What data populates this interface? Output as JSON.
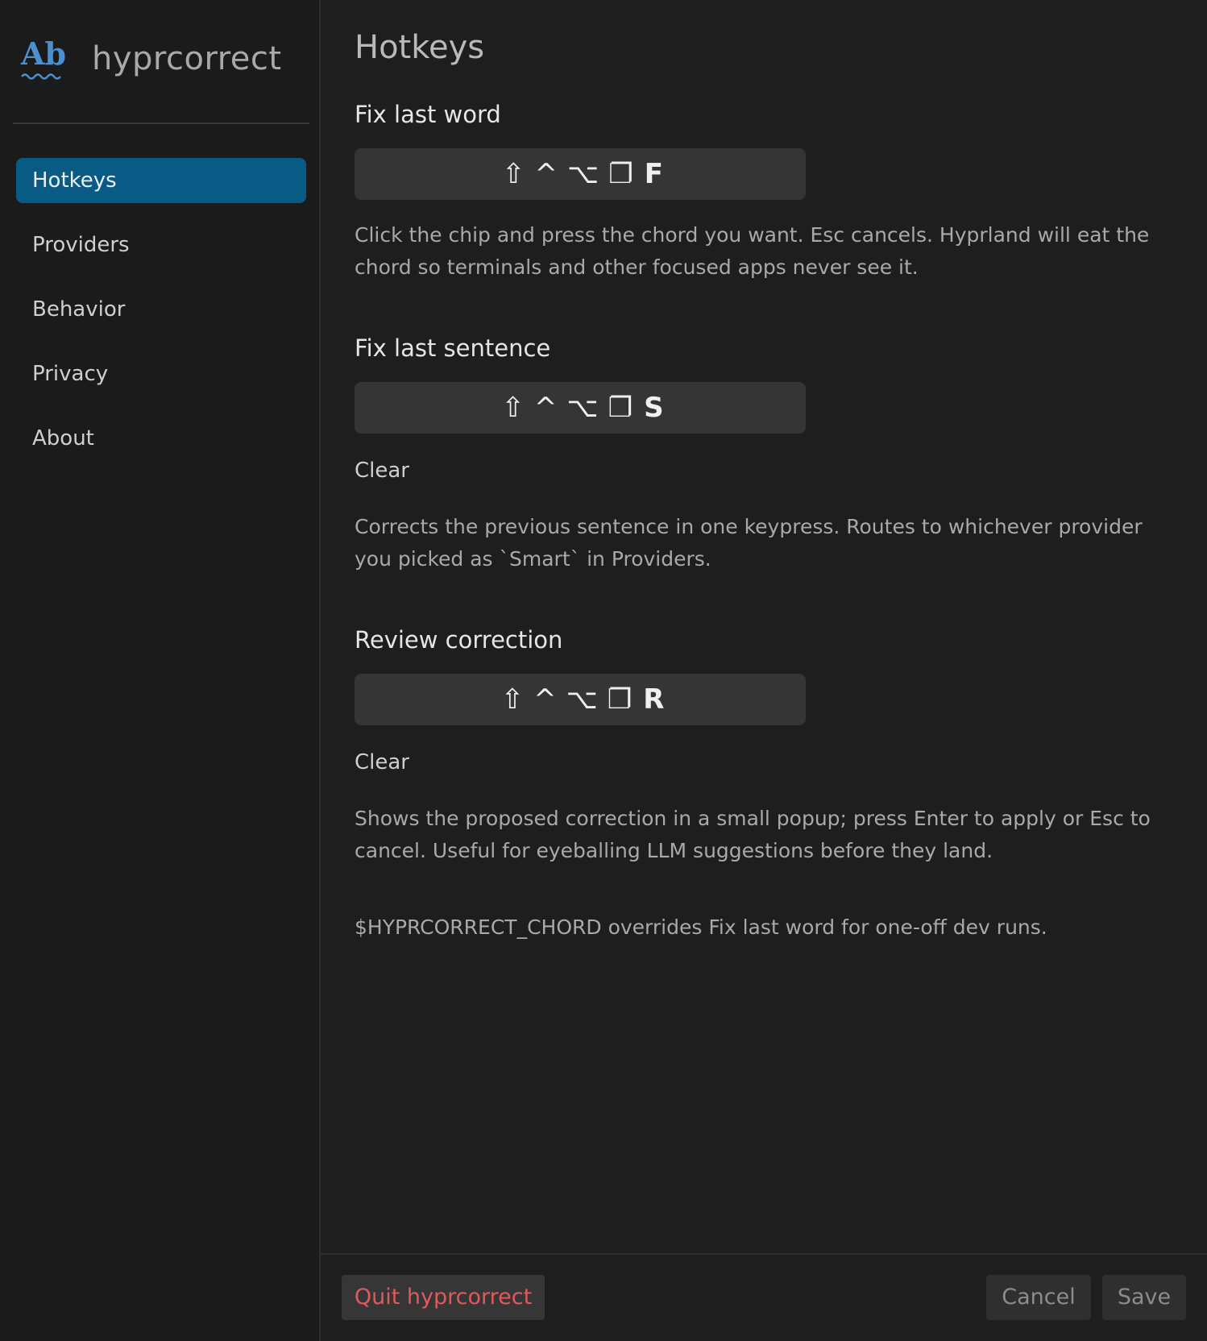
{
  "app": {
    "logo_text": "Ab",
    "name": "hyprcorrect"
  },
  "sidebar": {
    "items": [
      {
        "label": "Hotkeys",
        "active": true
      },
      {
        "label": "Providers",
        "active": false
      },
      {
        "label": "Behavior",
        "active": false
      },
      {
        "label": "Privacy",
        "active": false
      },
      {
        "label": "About",
        "active": false
      }
    ]
  },
  "main": {
    "title": "Hotkeys",
    "sections": [
      {
        "title": "Fix last word",
        "chord": {
          "mods": [
            "⇧",
            "^",
            "⌥",
            "❐"
          ],
          "key": "F"
        },
        "clear_label": "",
        "help": "Click the chip and press the chord you want. Esc cancels. Hyprland will eat the chord so terminals and other focused apps never see it."
      },
      {
        "title": "Fix last sentence",
        "chord": {
          "mods": [
            "⇧",
            "^",
            "⌥",
            "❐"
          ],
          "key": "S"
        },
        "clear_label": "Clear",
        "help": "Corrects the previous sentence in one keypress. Routes to whichever provider you picked as `Smart` in Providers."
      },
      {
        "title": "Review correction",
        "chord": {
          "mods": [
            "⇧",
            "^",
            "⌥",
            "❐"
          ],
          "key": "R"
        },
        "clear_label": "Clear",
        "help": "Shows the proposed correction in a small popup; press Enter to apply or Esc to cancel. Useful for eyeballing LLM suggestions before they land."
      }
    ],
    "footer_note": "$HYPRCORRECT_CHORD overrides Fix last word for one-off dev runs."
  },
  "footer": {
    "quit_label": "Quit hyprcorrect",
    "cancel_label": "Cancel",
    "save_label": "Save"
  },
  "colors": {
    "accent": "#0a5a86",
    "logo": "#4a8fd0",
    "danger": "#e05a5a",
    "background": "#1e1e1e"
  }
}
